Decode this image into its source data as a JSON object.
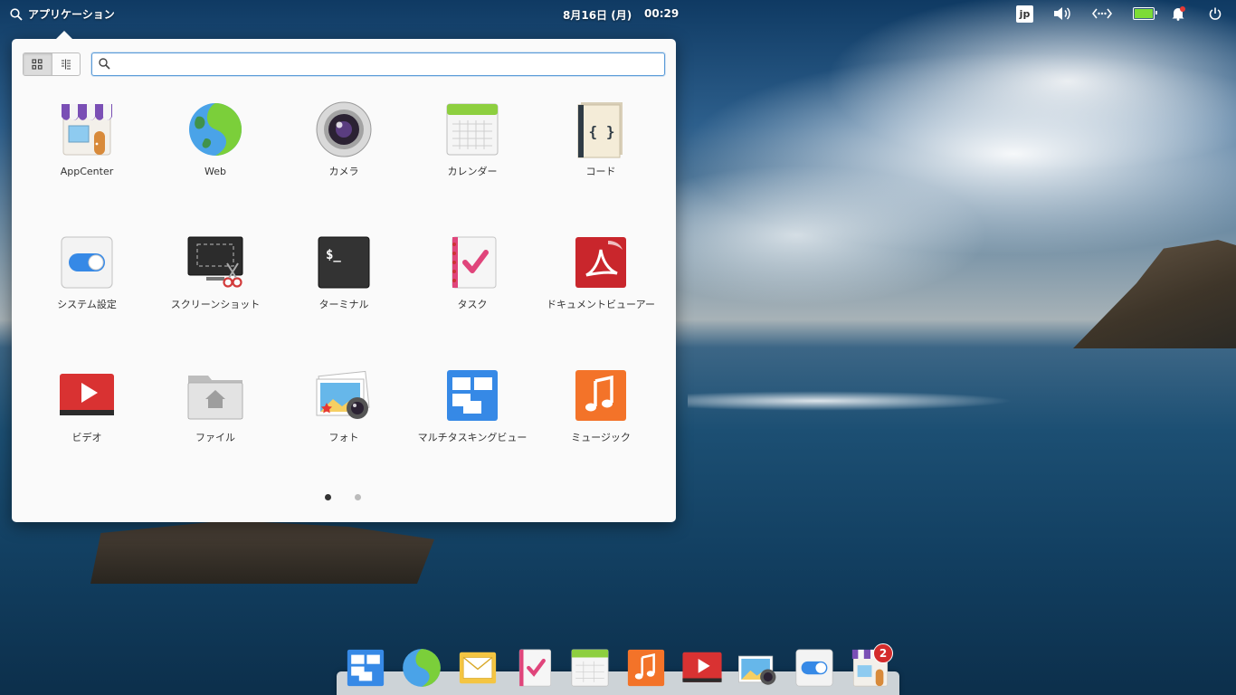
{
  "panel": {
    "applications_label": "アプリケーション",
    "date": "8月16日 (月)",
    "time": "00:29",
    "keyboard_layout": "jp"
  },
  "launcher": {
    "search_placeholder": "",
    "view_mode": "grid",
    "apps": [
      {
        "label": "AppCenter",
        "icon": "appcenter-icon"
      },
      {
        "label": "Web",
        "icon": "web-browser-icon"
      },
      {
        "label": "カメラ",
        "icon": "camera-icon"
      },
      {
        "label": "カレンダー",
        "icon": "calendar-icon"
      },
      {
        "label": "コード",
        "icon": "code-editor-icon"
      },
      {
        "label": "システム設定",
        "icon": "system-settings-icon"
      },
      {
        "label": "スクリーンショット",
        "icon": "screenshot-icon"
      },
      {
        "label": "ターミナル",
        "icon": "terminal-icon"
      },
      {
        "label": "タスク",
        "icon": "tasks-icon"
      },
      {
        "label": "ドキュメントビューアー",
        "icon": "document-viewer-icon"
      },
      {
        "label": "ビデオ",
        "icon": "videos-icon"
      },
      {
        "label": "ファイル",
        "icon": "files-icon"
      },
      {
        "label": "フォト",
        "icon": "photos-icon"
      },
      {
        "label": "マルチタスキングビュー",
        "icon": "multitasking-view-icon"
      },
      {
        "label": "ミュージック",
        "icon": "music-icon"
      }
    ],
    "pages": 2,
    "current_page": 1
  },
  "dock": {
    "items": [
      "multitasking-view-icon",
      "web-browser-icon",
      "mail-icon",
      "tasks-icon",
      "calendar-icon",
      "music-icon",
      "videos-icon",
      "photos-icon",
      "system-settings-icon",
      "appcenter-icon"
    ],
    "appcenter_badge": "2"
  },
  "colors": {
    "accent": "#3689e6",
    "battery": "#7ddc36",
    "badge": "#d42c2c"
  }
}
